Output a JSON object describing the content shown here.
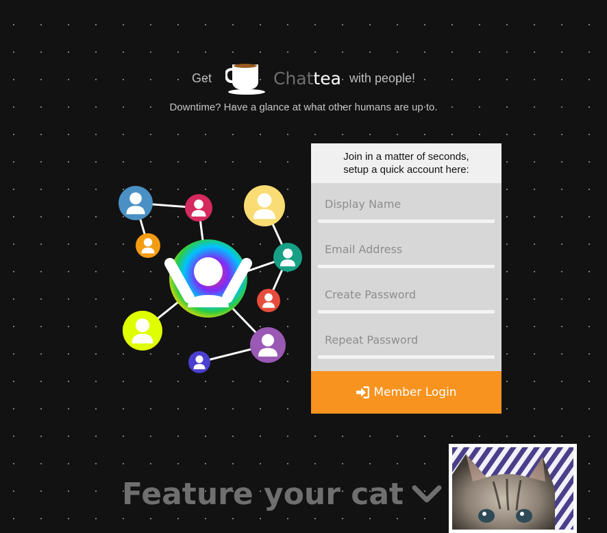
{
  "hero": {
    "get": "Get",
    "brand_chat": "Chat",
    "brand_tea": "tea",
    "tail": "with people!",
    "cup_icon": "coffee-cup-icon"
  },
  "subtitle": "Downtime? Have a glance at what other humans are up to.",
  "signup": {
    "heading_line1": "Join in a matter of seconds,",
    "heading_line2": "setup a quick account here:",
    "display_name_placeholder": "Display Name",
    "email_placeholder": "Email Address",
    "password_placeholder": "Create Password",
    "repeat_password_placeholder": "Repeat Password",
    "login_label": "Member Login",
    "login_icon": "sign-in-icon"
  },
  "feature": {
    "label": "Feature your cat",
    "icon": "chevron-down-icon"
  },
  "colors": {
    "background": "#121212",
    "accent": "#f7931e",
    "card": "#d7d7d7",
    "card_head": "#f0f0f1",
    "node_blue": "#4a90c4",
    "node_pink": "#d42a5e",
    "node_orange": "#f39c12",
    "node_yellow": "#f9dc73",
    "node_teal": "#16a085",
    "node_red": "#e74c3c",
    "node_lime": "#dfff00",
    "node_purple": "#9b59b6",
    "node_indigo": "#4b3fd0"
  }
}
